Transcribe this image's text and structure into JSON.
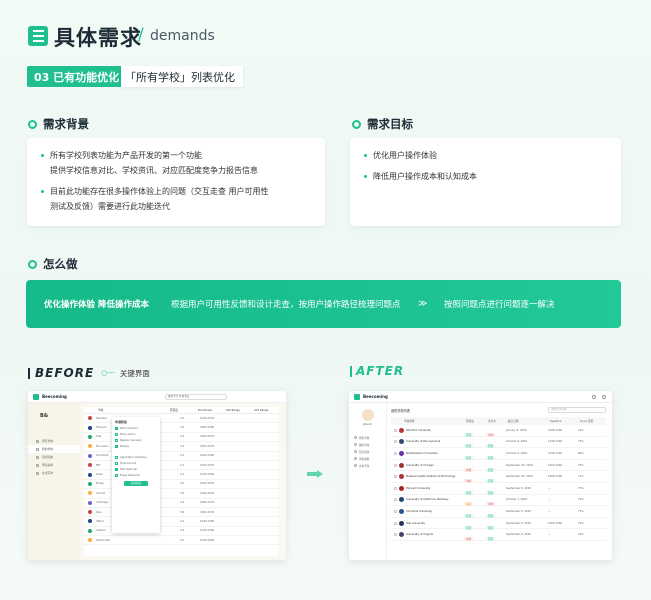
{
  "header": {
    "title_cn": "具体需求",
    "slash": "/",
    "title_en": "demands"
  },
  "section": {
    "pill": "03 已有功能优化",
    "pill_desc": "「所有学校」列表优化"
  },
  "background": {
    "heading": "需求背景",
    "items": [
      {
        "line1": "所有学校列表功能为产品开发的第一个功能",
        "line2": "提供学校信息对比、学校资讯、对应匹配度竞争力报告信息"
      },
      {
        "line1": "目前此功能存在很多操作体验上的问题（交互走查 用户可用性",
        "line2": "测试及反馈）需要进行此功能迭代"
      }
    ]
  },
  "goals": {
    "heading": "需求目标",
    "items": [
      "优化用户操作体验",
      "降低用户操作成本和认知成本"
    ]
  },
  "how": {
    "heading": "怎么做",
    "banner_title": "优化操作体验 降低操作成本",
    "banner_step1": "根据用户可用性反馈和设计走查，按用户操作路径梳理问题点",
    "banner_arrow": "≫",
    "banner_step2": "按照问题点进行问题逐一解决"
  },
  "before": {
    "label": "BEFORE",
    "key_label": "关键界面",
    "app_name": "Beecoming",
    "search": "搜索大学 查询专业",
    "columns": [
      "学校",
      "匹配度",
      "Enrollment",
      "SAT Range",
      "ACT Range"
    ],
    "side_items": [
      "所有学校",
      "我的学校",
      "目标院校",
      "申请资料",
      "文书写作"
    ],
    "rows": [
      {
        "name": "Stanford",
        "val": "4.5",
        "sat": "1440-1570"
      },
      {
        "name": "Harvard",
        "val": "4.6",
        "sat": "1460-1580"
      },
      {
        "name": "Yale",
        "val": "4.4",
        "sat": "1460-1570"
      },
      {
        "name": "Princeton",
        "val": "4.3",
        "sat": "1450-1570"
      },
      {
        "name": "Columbia",
        "val": "4.2",
        "sat": "1450-1560"
      },
      {
        "name": "MIT",
        "val": "4.7",
        "sat": "1500-1570"
      },
      {
        "name": "Duke",
        "val": "4.1",
        "sat": "1420-1560"
      },
      {
        "name": "Brown",
        "val": "4.0",
        "sat": "1420-1550"
      },
      {
        "name": "Cornell",
        "val": "3.9",
        "sat": "1390-1540"
      },
      {
        "name": "UChicago",
        "val": "4.3",
        "sat": "1480-1570"
      },
      {
        "name": "Rice",
        "val": "3.8",
        "sat": "1460-1570"
      },
      {
        "name": "UPenn",
        "val": "4.2",
        "sat": "1440-1560"
      },
      {
        "name": "Caltech",
        "val": "4.4",
        "sat": "1530-1580"
      },
      {
        "name": "Dartmouth",
        "val": "4.0",
        "sat": "1420-1560"
      }
    ],
    "dropdown_title": "申请阶段",
    "dropdown_items": [
      "Early Decision",
      "Early Action",
      "Regular Decision",
      "Rolling",
      "Application Deadline",
      "Financial Aid",
      "Test Optional",
      "Essay Required"
    ],
    "dropdown_button": "应用筛选"
  },
  "after": {
    "label": "AFTER",
    "app_name": "Beecoming",
    "user_name": "gdenlin",
    "page_title": "我的学校列表",
    "search": "搜索大学名称",
    "columns": [
      "学校名称",
      "匹配度",
      "竞争力",
      "截止日期",
      "Deadline",
      "Score 匹配"
    ],
    "side_items": [
      "所有学校",
      "我的学校",
      "目标院校",
      "申请资料",
      "文书写作"
    ],
    "rows": [
      {
        "name": "Stanford University",
        "a": "匹配",
        "b": "冲刺",
        "date": "January 8, 2020",
        "sat": "1480-1560",
        "n": "72%"
      },
      {
        "name": "University of Pennsylvania",
        "a": "匹配",
        "b": "匹配",
        "date": "October 8, 2020",
        "sat": "1440-1560",
        "n": "73%"
      },
      {
        "name": "Northwestern University",
        "a": "匹配",
        "b": "匹配",
        "date": "October 8, 2020",
        "sat": "1440-1560",
        "n": "80%"
      },
      {
        "name": "University of Chicago",
        "a": "冲刺",
        "b": "匹配",
        "date": "September 30, 2020",
        "sat": "1460-1560",
        "n": "75%"
      },
      {
        "name": "Massachusetts Institute of Technology",
        "a": "冲刺",
        "b": "匹配",
        "date": "September 30, 2020",
        "sat": "1480-1560",
        "n": "71%"
      },
      {
        "name": "Harvard University",
        "a": "匹配",
        "b": "匹配",
        "date": "September 8, 2020",
        "sat": "—",
        "n": "75%"
      },
      {
        "name": "University of California, Berkeley",
        "a": "保底",
        "b": "冲刺",
        "date": "October 1, 2020",
        "sat": "—",
        "n": "72%"
      },
      {
        "name": "Columbia University",
        "a": "匹配",
        "b": "匹配",
        "date": "September 8, 2020",
        "sat": "—",
        "n": "73%"
      },
      {
        "name": "Yale University",
        "a": "匹配",
        "b": "匹配",
        "date": "September 8, 2020",
        "sat": "1460-1560",
        "n": "72%"
      },
      {
        "name": "University of Virginia",
        "a": "冲刺",
        "b": "匹配",
        "date": "September 8, 2020",
        "sat": "—",
        "n": "74%"
      }
    ]
  },
  "colors": {
    "accent": "#1fbf8f",
    "text": "#1d2b36"
  }
}
